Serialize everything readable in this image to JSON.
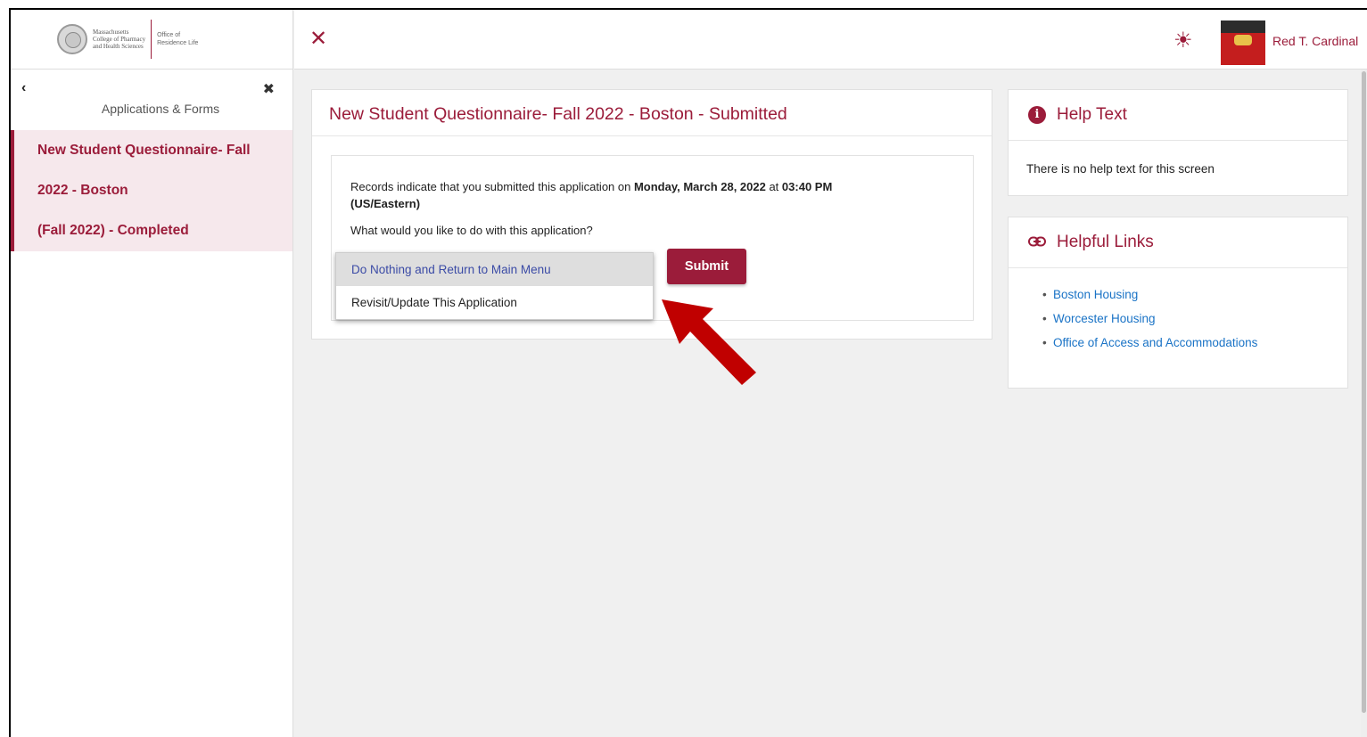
{
  "logo": {
    "line1": "Massachusetts",
    "line2": "College of Pharmacy",
    "line3": "and Health Sciences",
    "office_line1": "Office of",
    "office_line2": "Residence Life"
  },
  "sidebar": {
    "back_glyph": "‹",
    "close_glyph": "✖",
    "heading": "Applications & Forms",
    "item": {
      "line1": "New Student Questionnaire- Fall",
      "line2": "2022 - Boston",
      "line3": "(Fall 2022) - Completed"
    }
  },
  "topbar": {
    "close_glyph": "✕",
    "theme_glyph": "☀",
    "user_name": "Red T. Cardinal"
  },
  "main": {
    "title": "New Student Questionnaire- Fall 2022 - Boston - Submitted",
    "records_prefix": "Records indicate that you submitted this application on ",
    "records_date": "Monday, March 28, 2022",
    "records_mid": " at ",
    "records_time": "03:40 PM (US/Eastern)",
    "question": "What would you like to do with this application?",
    "dropdown_options": [
      "Do Nothing and Return to Main Menu",
      "Revisit/Update This Application"
    ],
    "submit_label": "Submit"
  },
  "help": {
    "title": "Help Text",
    "body": "There is no help text for this screen"
  },
  "links": {
    "title": "Helpful Links",
    "items": [
      "Boston Housing",
      "Worcester Housing",
      "Office of Access and Accommodations"
    ]
  },
  "colors": {
    "accent": "#9b1c3a",
    "link": "#1a73c6",
    "arrow": "#c00000"
  }
}
